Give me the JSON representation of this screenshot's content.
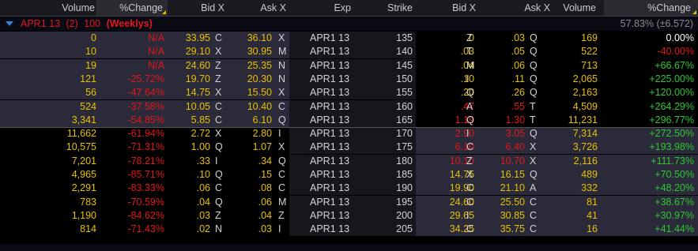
{
  "colors": {
    "header_text": "#c8c8d0",
    "group_red": "#e01818",
    "neutral": "#d4d4d4",
    "white": "#ffffff",
    "red": "#e01818",
    "green": "#31c831",
    "yellow": "#e8c000",
    "exchange": "#d4d4d4"
  },
  "header": {
    "calls": [
      "Volume",
      "%Change",
      "Bid X",
      "Ask X"
    ],
    "mid": [
      "Exp",
      "Strike"
    ],
    "puts": [
      "Bid X",
      "Ask X",
      "Volume",
      "%Change"
    ]
  },
  "group": {
    "expiry": "APR1 13",
    "count": "(2)",
    "multiplier": "100",
    "tag": "(Weeklys)",
    "right_pct": "57.83%",
    "right_vol": "(±6.572)"
  },
  "rows": [
    {
      "c_vol": "0",
      "c_chg": "N/A",
      "c_bid": "33.95",
      "c_bx": "C",
      "c_ask": "36.10",
      "c_ax": "X",
      "exp": "APR1 13",
      "strike": "135",
      "p_bid": "0",
      "p_bx": "Z",
      "p_ask": ".03",
      "p_ax": "Q",
      "p_vol": "169",
      "p_chg": "0.00%"
    },
    {
      "c_vol": "10",
      "c_chg": "N/A",
      "c_bid": "29.10",
      "c_bx": "X",
      "c_ask": "30.95",
      "c_ax": "M",
      "exp": "APR1 13",
      "strike": "140",
      "p_bid": ".03",
      "p_bx": "T",
      "p_ask": ".05",
      "p_ax": "Q",
      "p_vol": "522",
      "p_chg": "-40.00%"
    },
    {
      "c_vol": "19",
      "c_chg": "N/A",
      "c_bid": "24.60",
      "c_bx": "Z",
      "c_ask": "25.35",
      "c_ax": "N",
      "exp": "APR1 13",
      "strike": "145",
      "p_bid": ".04",
      "p_bx": "M",
      "p_ask": ".06",
      "p_ax": "Q",
      "p_vol": "713",
      "p_chg": "+66.67%"
    },
    {
      "c_vol": "121",
      "c_chg": "-25.72%",
      "c_bid": "19.70",
      "c_bx": "Z",
      "c_ask": "20.30",
      "c_ax": "N",
      "exp": "APR1 13",
      "strike": "150",
      "p_bid": ".10",
      "p_bx": "I",
      "p_ask": ".11",
      "p_ax": "Q",
      "p_vol": "2,065",
      "p_chg": "+225.00%"
    },
    {
      "c_vol": "56",
      "c_chg": "-47.64%",
      "c_bid": "14.75",
      "c_bx": "X",
      "c_ask": "15.50",
      "c_ax": "X",
      "exp": "APR1 13",
      "strike": "155",
      "p_bid": ".20",
      "p_bx": "Q",
      "p_ask": ".26",
      "p_ax": "Q",
      "p_vol": "2,163",
      "p_chg": "+120.00%"
    },
    {
      "c_vol": "524",
      "c_chg": "-37.58%",
      "c_bid": "10.05",
      "c_bx": "C",
      "c_ask": "10.40",
      "c_ax": "C",
      "exp": "APR1 13",
      "strike": "160",
      "p_bid": ".47",
      "p_bx": "A",
      "p_ask": ".55",
      "p_ax": "T",
      "p_vol": "4,509",
      "p_chg": "+264.29%"
    },
    {
      "c_vol": "3,341",
      "c_chg": "-54.85%",
      "c_bid": "5.85",
      "c_bx": "C",
      "c_ask": "6.10",
      "c_ax": "Q",
      "exp": "APR1 13",
      "strike": "165",
      "p_bid": "1.19",
      "p_bx": "Q",
      "p_ask": "1.30",
      "p_ax": "T",
      "p_vol": "11,231",
      "p_chg": "+296.77%"
    },
    {
      "c_vol": "11,662",
      "c_chg": "-61.94%",
      "c_bid": "2.72",
      "c_bx": "X",
      "c_ask": "2.80",
      "c_ax": "I",
      "exp": "APR1 13",
      "strike": "170",
      "p_bid": "2.90",
      "p_bx": "I",
      "p_ask": "3.05",
      "p_ax": "Q",
      "p_vol": "7,314",
      "p_chg": "+272.50%"
    },
    {
      "c_vol": "10,575",
      "c_chg": "-71.31%",
      "c_bid": "1.00",
      "c_bx": "Q",
      "c_ask": "1.07",
      "c_ax": "X",
      "exp": "APR1 13",
      "strike": "175",
      "p_bid": "6.10",
      "p_bx": "C",
      "p_ask": "6.40",
      "p_ax": "X",
      "p_vol": "3,726",
      "p_chg": "+193.98%"
    },
    {
      "c_vol": "7,201",
      "c_chg": "-78.21%",
      "c_bid": ".33",
      "c_bx": "I",
      "c_ask": ".34",
      "c_ax": "Q",
      "exp": "APR1 13",
      "strike": "180",
      "p_bid": "10.10",
      "p_bx": "Z",
      "p_ask": "10.70",
      "p_ax": "X",
      "p_vol": "2,116",
      "p_chg": "+111.73%"
    },
    {
      "c_vol": "4,965",
      "c_chg": "-85.71%",
      "c_bid": ".10",
      "c_bx": "Q",
      "c_ask": ".15",
      "c_ax": "C",
      "exp": "APR1 13",
      "strike": "185",
      "p_bid": "14.75",
      "p_bx": "X",
      "p_ask": "16.15",
      "p_ax": "Q",
      "p_vol": "489",
      "p_chg": "+70.50%"
    },
    {
      "c_vol": "2,291",
      "c_chg": "-83.33%",
      "c_bid": ".06",
      "c_bx": "C",
      "c_ask": ".08",
      "c_ax": "C",
      "exp": "APR1 13",
      "strike": "190",
      "p_bid": "19.90",
      "p_bx": "C",
      "p_ask": "21.10",
      "p_ax": "A",
      "p_vol": "332",
      "p_chg": "+48.20%"
    },
    {
      "c_vol": "783",
      "c_chg": "-70.59%",
      "c_bid": ".04",
      "c_bx": "Q",
      "c_ask": ".06",
      "c_ax": "M",
      "exp": "APR1 13",
      "strike": "195",
      "p_bid": "24.60",
      "p_bx": "C",
      "p_ask": "25.50",
      "p_ax": "C",
      "p_vol": "81",
      "p_chg": "+38.67%"
    },
    {
      "c_vol": "1,190",
      "c_chg": "-84.62%",
      "c_bid": ".03",
      "c_bx": "Z",
      "c_ask": ".04",
      "c_ax": "Z",
      "exp": "APR1 13",
      "strike": "200",
      "p_bid": "29.65",
      "p_bx": "I",
      "p_ask": "30.85",
      "p_ax": "C",
      "p_vol": "41",
      "p_chg": "+30.97%"
    },
    {
      "c_vol": "814",
      "c_chg": "-71.43%",
      "c_bid": ".02",
      "c_bx": "N",
      "c_ask": ".03",
      "c_ax": "I",
      "exp": "APR1 13",
      "strike": "205",
      "p_bid": "34.25",
      "p_bx": "C",
      "p_ask": "35.75",
      "p_ax": "C",
      "p_vol": "16",
      "p_chg": "+41.44%"
    }
  ]
}
